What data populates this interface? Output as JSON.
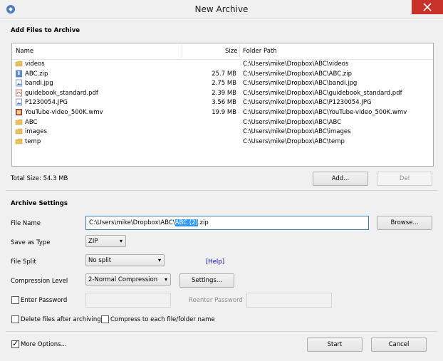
{
  "window": {
    "title": "New Archive"
  },
  "files": {
    "section_label": "Add Files to Archive",
    "columns": {
      "name": "Name",
      "size": "Size",
      "folder": "Folder Path"
    },
    "rows": [
      {
        "name": "videos",
        "size": "",
        "path": "C:\\Users\\mike\\Dropbox\\ABC\\videos",
        "icon": "folder-icon"
      },
      {
        "name": "ABC.zip",
        "size": "25.7 MB",
        "path": "C:\\Users\\mike\\Dropbox\\ABC\\ABC.zip",
        "icon": "zip-file-icon"
      },
      {
        "name": "bandi.jpg",
        "size": "2.75 MB",
        "path": "C:\\Users\\mike\\Dropbox\\ABC\\bandi.jpg",
        "icon": "image-file-icon"
      },
      {
        "name": "guidebook_standard.pdf",
        "size": "2.39 MB",
        "path": "C:\\Users\\mike\\Dropbox\\ABC\\guidebook_standard.pdf",
        "icon": "pdf-file-icon"
      },
      {
        "name": "P1230054.JPG",
        "size": "3.56 MB",
        "path": "C:\\Users\\mike\\Dropbox\\ABC\\P1230054.JPG",
        "icon": "image-file-icon"
      },
      {
        "name": "YouTube-video_500K.wmv",
        "size": "19.9 MB",
        "path": "C:\\Users\\mike\\Dropbox\\ABC\\YouTube-video_500K.wmv",
        "icon": "video-file-icon"
      },
      {
        "name": "ABC",
        "size": "",
        "path": "C:\\Users\\mike\\Dropbox\\ABC\\ABC",
        "icon": "folder-icon"
      },
      {
        "name": "images",
        "size": "",
        "path": "C:\\Users\\mike\\Dropbox\\ABC\\images",
        "icon": "folder-icon"
      },
      {
        "name": "temp",
        "size": "",
        "path": "C:\\Users\\mike\\Dropbox\\ABC\\temp",
        "icon": "folder-icon"
      }
    ],
    "total_size": "Total Size: 54.3 MB",
    "add_label": "Add...",
    "del_label": "Del"
  },
  "settings": {
    "section_label": "Archive Settings",
    "file_name_label": "File Name",
    "file_name_prefix": "C:\\Users\\mike\\Dropbox\\ABC\\",
    "file_name_selected": "ABC (2)",
    "file_name_suffix": ".zip",
    "browse_label": "Browse...",
    "save_type_label": "Save as Type",
    "save_type_value": "ZIP",
    "split_label": "File Split",
    "split_value": "No split",
    "help_label": "[Help]",
    "compression_label": "Compression Level",
    "compression_value": "2-Normal Compression",
    "settings_button": "Settings...",
    "enter_password_label": "Enter Password",
    "reenter_password_label": "Reenter Password",
    "delete_files_label": "Delete files after archiving",
    "compress_each_label": "Compress to each file/folder name"
  },
  "footer": {
    "more_options_label": "More Options...",
    "start_label": "Start",
    "cancel_label": "Cancel"
  },
  "colors": {
    "close_button": "#c7312a",
    "selection": "#3399ff",
    "link": "#0000ee"
  }
}
